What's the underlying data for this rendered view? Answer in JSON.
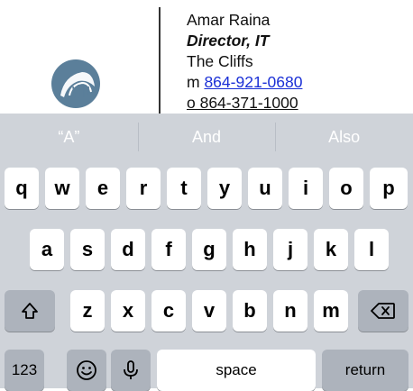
{
  "signature": {
    "name": "Amar Raina",
    "title": "Director, IT",
    "company": "The Cliffs",
    "mobile_prefix": "m",
    "mobile": "864-921-0680",
    "office_partial": "o 864-371-1000"
  },
  "keyboard": {
    "predictions": [
      "“A”",
      "And",
      "Also"
    ],
    "row1": [
      "q",
      "w",
      "e",
      "r",
      "t",
      "y",
      "u",
      "i",
      "o",
      "p"
    ],
    "row2": [
      "a",
      "s",
      "d",
      "f",
      "g",
      "h",
      "j",
      "k",
      "l"
    ],
    "row3": [
      "z",
      "x",
      "c",
      "v",
      "b",
      "n",
      "m"
    ],
    "numbers_label": "123",
    "space_label": "space",
    "return_label": "return",
    "icons": {
      "shift": "shift-icon",
      "delete": "backspace-icon",
      "emoji": "emoji-icon",
      "mic": "microphone-icon"
    }
  },
  "colors": {
    "keyboard_bg": "#cfd3d9",
    "special_key_bg": "#adb3bc",
    "link": "#1a2fd6",
    "logo": "#5b7f9a"
  }
}
